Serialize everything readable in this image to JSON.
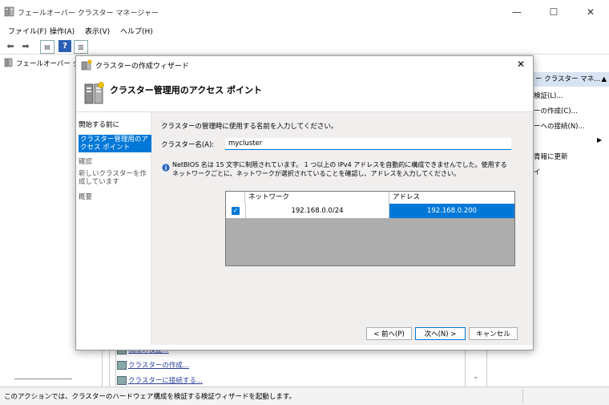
{
  "main_window": {
    "title": "フェールオーバー クラスター マネージャー",
    "controls": {
      "minimize": "—",
      "maximize": "☐",
      "close": "✕"
    }
  },
  "menubar": [
    "ファイル(F)",
    "操作(A)",
    "表示(V)",
    "ヘルプ(H)"
  ],
  "tree": {
    "root_label": "フェールオーバー クラ"
  },
  "actions_pane": {
    "header": "ー クラスター マネ...",
    "items": [
      "検証(L)...",
      "ーの作成(C)...",
      "ーへの接続(N)...",
      "青報に更新",
      "イ"
    ]
  },
  "center_links": [
    "構成の検証...",
    "クラスターの作成...",
    "クラスターに接続する..."
  ],
  "status_text": "このアクションでは、クラスターのハードウェア構成を検証する検証ウィザードを起動します。",
  "dialog": {
    "title": "クラスターの作成ウィザード",
    "header": "クラスター管理用のアクセス ポイント",
    "steps": [
      {
        "label": "開始する前に",
        "active": false
      },
      {
        "label": "クラスター管理用のアクセス ポイント",
        "active": true
      },
      {
        "label": "確認",
        "active": false
      },
      {
        "label": "新しいクラスターを作成しています",
        "active": false
      },
      {
        "label": "概要",
        "active": false
      }
    ],
    "instruction": "クラスターの管理時に使用する名前を入力してください。",
    "name_label": "クラスター名(A):",
    "name_value": "mycluster",
    "info_text_1": "NetBIOS 名は 15 文字に制限されています。 1 つ以上の IPv4 アドレスを自動的に構成できませんでした。使用する",
    "info_text_2": "ネットワークごとに、ネットワークが選択されていることを確認し、アドレスを入力してください。",
    "table": {
      "headers": [
        "ネットワーク",
        "アドレス"
      ],
      "rows": [
        {
          "checked": true,
          "network": "192.168.0.0/24",
          "address": "192.168.0.200"
        }
      ]
    },
    "buttons": {
      "back": "< 前へ(P)",
      "next": "次へ(N) >",
      "cancel": "キャンセル"
    }
  },
  "colors": {
    "accent": "#0078d7",
    "table_empty": "#adadad",
    "content_bg": "#f1eeee"
  }
}
